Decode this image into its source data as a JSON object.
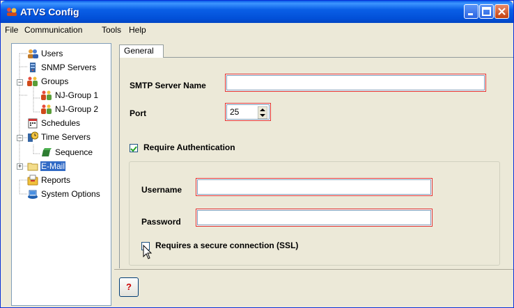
{
  "window": {
    "title": "ATVS Config"
  },
  "menu": [
    "File",
    "Communication",
    "Tools",
    "Help"
  ],
  "tree": {
    "items": [
      {
        "label": "Users",
        "icon": "users-icon"
      },
      {
        "label": "SNMP Servers",
        "icon": "server-icon"
      },
      {
        "label": "Groups",
        "icon": "groups-icon"
      },
      {
        "label": "NJ-Group 1",
        "icon": "group-icon"
      },
      {
        "label": "NJ-Group 2",
        "icon": "group-icon"
      },
      {
        "label": "Schedules",
        "icon": "calendar-icon"
      },
      {
        "label": "Time Servers",
        "icon": "time-server-icon"
      },
      {
        "label": "Sequence",
        "icon": "sequence-icon"
      },
      {
        "label": "E-Mail",
        "icon": "folder-icon"
      },
      {
        "label": "Reports",
        "icon": "reports-icon"
      },
      {
        "label": "System Options",
        "icon": "system-options-icon"
      }
    ],
    "selected": "E-Mail"
  },
  "tab": {
    "label": "General"
  },
  "form": {
    "smtp_label": "SMTP Server Name",
    "smtp_value": "",
    "port_label": "Port",
    "port_value": "25",
    "require_auth_label": "Require Authentication",
    "require_auth_checked": true,
    "username_label": "Username",
    "username_value": "",
    "password_label": "Password",
    "password_value": "",
    "ssl_label": "Requires a secure connection (SSL)",
    "ssl_checked": false
  },
  "help_button": {
    "label": "?"
  },
  "colors": {
    "titlebar": "#0a5ce8",
    "highlight": "#e0302e",
    "selection": "#316ac5"
  }
}
